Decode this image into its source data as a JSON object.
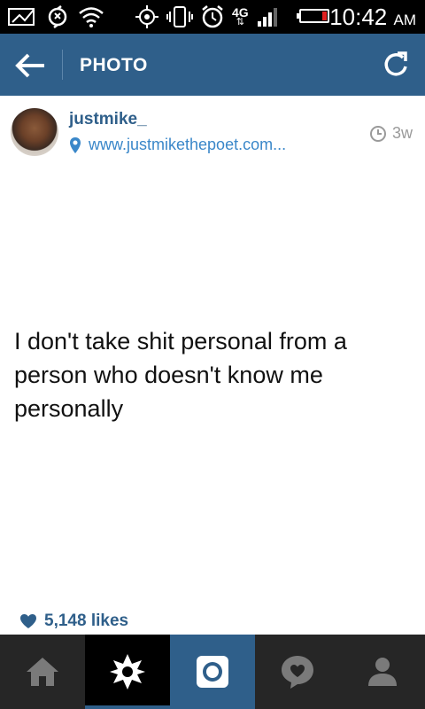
{
  "status_bar": {
    "time": "10:42",
    "ampm": "AM",
    "network": "4G"
  },
  "top_bar": {
    "title": "PHOTO"
  },
  "post": {
    "username": "justmike_",
    "location": "www.justmikethepoet.com...",
    "time_ago": "3w",
    "quote": "I don't take shit personal from a person who doesn't know me personally",
    "likes": "5,148 likes"
  },
  "nav": {
    "items": [
      "home-icon",
      "explore-icon",
      "camera-icon",
      "activity-icon",
      "profile-icon"
    ],
    "active": "explore-icon"
  },
  "colors": {
    "brand": "#2f5f8a",
    "link": "#3a87c9",
    "statusbar": "#000000",
    "navbar": "#262626",
    "battery_low": "#e02020"
  }
}
